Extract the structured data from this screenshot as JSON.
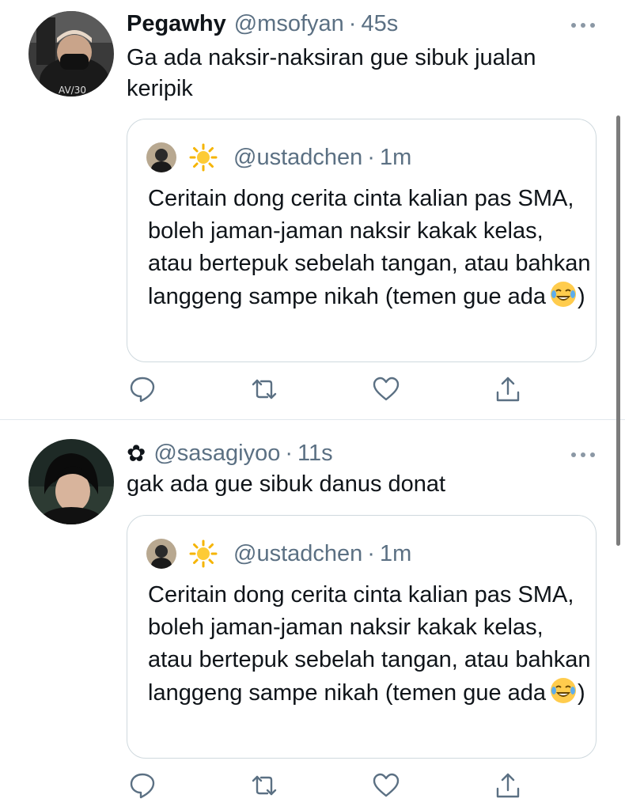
{
  "tweets": [
    {
      "name": "Pegawhy",
      "handle": "@msofyan",
      "time": "45s",
      "text": "Ga ada naksir-naksiran gue sibuk jualan keripik",
      "quote": {
        "handle": "@ustadchen",
        "time": "1m",
        "text": "Ceritain dong cerita cinta kalian pas SMA, boleh jaman-jaman naksir kakak kelas, atau bertepuk sebelah tangan, atau bahkan langgeng sampe nikah (temen gue ada",
        "text_end": ")",
        "emoji": "face-with-tears-of-joy"
      }
    },
    {
      "name": "✿",
      "handle": "@sasagiyoo",
      "time": "11s",
      "text": "gak ada gue sibuk danus donat",
      "quote": {
        "handle": "@ustadchen",
        "time": "1m",
        "text": "Ceritain dong cerita cinta kalian pas SMA, boleh jaman-jaman naksir kakak kelas, atau bertepuk sebelah tangan, atau bahkan langgeng sampe nikah (temen gue ada",
        "text_end": ")",
        "emoji": "face-with-tears-of-joy"
      }
    }
  ],
  "icons": [
    "reply-icon",
    "retweet-icon",
    "like-icon",
    "share-icon",
    "more-icon",
    "sun-icon"
  ],
  "colors": {
    "text": "#0f1419",
    "secondary": "#5b7083",
    "border": "#cfd9de"
  }
}
